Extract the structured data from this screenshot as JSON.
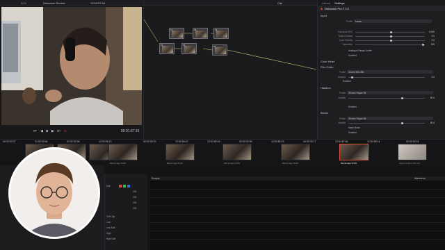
{
  "viewer": {
    "title": "Dehancer Review",
    "timecode": "12:54:57:04",
    "zoom": "52%",
    "playback_timecode": "00:01:57:16"
  },
  "nodes_bar": {
    "clip_label": "Clip"
  },
  "settings": {
    "tab_library": "Library",
    "tab_settings": "Settings",
    "plugin_title": "Dehancer Pro 7.1.6",
    "input_section": "Input",
    "profile_label": "Profile",
    "profile_value": "Linear",
    "rows": [
      {
        "label": "Exposure (EV)",
        "value": "0.000"
      },
      {
        "label": "Tonal Contrast",
        "value": "0.0"
      },
      {
        "label": "Color Density",
        "value": "0.0"
      },
      {
        "label": "Saturation",
        "value": "100"
      }
    ],
    "analogue_check": "Analogue Range Limiter",
    "enabled_label": "Enabled",
    "color_head_section": "Color Head",
    "film_grain_section": "Film Grain",
    "grain_profile_value": "16 mm ISO 250",
    "grain_amount_label": "Amount",
    "grain_amount_value": "0.0",
    "halation_section": "Halation",
    "halation_profile": "35 mm / Super 35",
    "halation_amplify_label": "Amplify",
    "halation_amplify_value": "50.0",
    "bloom_section": "Bloom",
    "bloom_profile": "35 mm / Super 35",
    "bloom_amplify_value": "50.0",
    "mask_mode_label": "Mask Mode"
  },
  "timeline": {
    "timecodes": [
      "00:00:02:07",
      "01:02:33:04",
      "01:02:33:26",
      "12:54:55:13",
      "00:00:00:19",
      "12:54:54:07",
      "12:54:55:19",
      "00:00:02:05",
      "12:54:56:15",
      "00:00:02:17",
      "12:54:57:04",
      "12:54:58:14",
      "00:00:00:15"
    ]
  },
  "clips": [
    {
      "label": "Blackmagic RAW"
    },
    {
      "label": "Blackmagic RAW"
    },
    {
      "label": "Blackmagic RAW"
    },
    {
      "label": "Blackmagic RAW"
    },
    {
      "label": "Blackmagic RAW"
    },
    {
      "label": "Blackmagic RAW"
    },
    {
      "label": "Apple ProRes 422 HQ"
    }
  ],
  "bottom": {
    "edit_label": "Edit",
    "channel_values": [
      "100",
      "100",
      "100",
      "100"
    ],
    "soft_clip_label": "Soft Clip",
    "soft_rows": [
      "Low",
      "Low Soft",
      "High",
      "High Soft"
    ],
    "scope_title": "Scopes",
    "scope_mode": "Waveform"
  },
  "colors": {
    "accent": "#e2503a",
    "red": "#e04848",
    "green": "#3fbf4c",
    "blue": "#3d6fe0"
  }
}
